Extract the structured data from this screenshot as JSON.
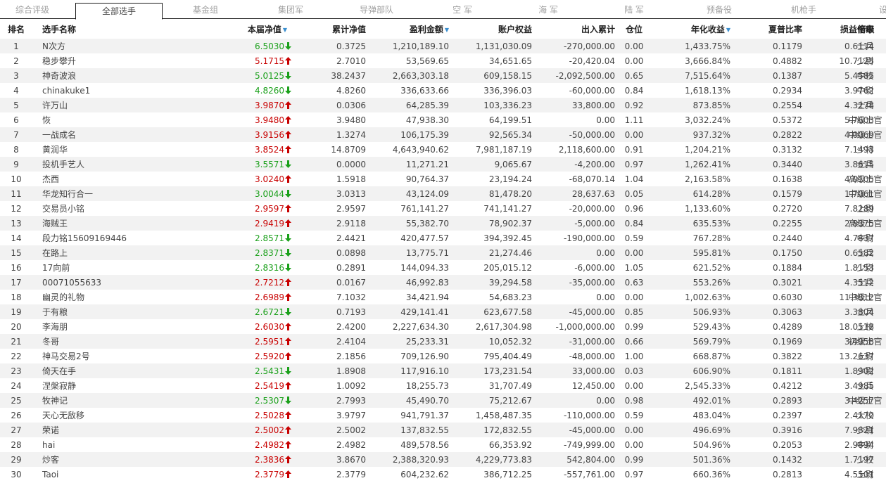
{
  "tabs": [
    "综合评级",
    "全部选手",
    "基金组",
    "集团军",
    "导弹部队",
    "空 军",
    "海 军",
    "陆 军",
    "预备役",
    "机枪手"
  ],
  "tab_more": "设",
  "active_tab": 1,
  "headers": [
    "排名",
    "选手名称",
    "本届净值",
    "累计净值",
    "盈利金额",
    "账户权益",
    "出入累计",
    "仓位",
    "年化收益",
    "夏普比率",
    "损益倍率",
    "衔级"
  ],
  "sorted_columns": [
    2,
    4,
    9
  ],
  "sort_icon": "▼",
  "colors": {
    "up": "#c80000",
    "down": "#1aa01a"
  },
  "rows": [
    {
      "rank": "1",
      "name": "N次方",
      "nav": "6.5030",
      "dir": "down",
      "cum": "0.3725",
      "profit": "1,210,189.10",
      "equity": "1,131,030.09",
      "flow": "-270,000.00",
      "pos": "0.00",
      "annual": "1,433.75%",
      "sharpe": "0.1179",
      "pl": "0.6114",
      "grade": "士兵"
    },
    {
      "rank": "2",
      "name": "稳步攀升",
      "nav": "5.1715",
      "dir": "up",
      "cum": "2.7010",
      "profit": "53,569.65",
      "equity": "34,651.65",
      "flow": "-20,420.04",
      "pos": "0.00",
      "annual": "3,666.84%",
      "sharpe": "0.4882",
      "pl": "10.7125",
      "grade": "少尉"
    },
    {
      "rank": "3",
      "name": "神奇波浪",
      "nav": "5.0125",
      "dir": "down",
      "cum": "38.2437",
      "profit": "2,663,303.18",
      "equity": "609,158.15",
      "flow": "-2,092,500.00",
      "pos": "0.65",
      "annual": "7,515.64%",
      "sharpe": "0.1387",
      "pl": "5.4585",
      "grade": "中校"
    },
    {
      "rank": "4",
      "name": "chinakuke1",
      "nav": "4.8260",
      "dir": "down",
      "cum": "4.8260",
      "profit": "336,633.66",
      "equity": "336,396.03",
      "flow": "-60,000.00",
      "pos": "0.84",
      "annual": "1,618.13%",
      "sharpe": "0.2934",
      "pl": "3.9762",
      "grade": "中尉"
    },
    {
      "rank": "5",
      "name": "许万山",
      "nav": "3.9870",
      "dir": "up",
      "cum": "0.0306",
      "profit": "64,285.39",
      "equity": "103,336.23",
      "flow": "33,800.00",
      "pos": "0.92",
      "annual": "873.85%",
      "sharpe": "0.2554",
      "pl": "4.3278",
      "grade": "士兵"
    },
    {
      "rank": "6",
      "name": "恢",
      "nav": "3.9480",
      "dir": "up",
      "cum": "3.9480",
      "profit": "47,938.30",
      "equity": "64,199.51",
      "flow": "0.00",
      "pos": "1.11",
      "annual": "3,032.24%",
      "sharpe": "0.5372",
      "pl": "5.7603",
      "grade": "中级士官"
    },
    {
      "rank": "7",
      "name": "一战成名",
      "nav": "3.9156",
      "dir": "up",
      "cum": "1.3274",
      "profit": "106,175.39",
      "equity": "92,565.34",
      "flow": "-50,000.00",
      "pos": "0.00",
      "annual": "937.32%",
      "sharpe": "0.2822",
      "pl": "4.0069",
      "grade": "中级士官"
    },
    {
      "rank": "8",
      "name": "黄润华",
      "nav": "3.8524",
      "dir": "up",
      "cum": "14.8709",
      "profit": "4,643,940.62",
      "equity": "7,981,187.19",
      "flow": "2,118,600.00",
      "pos": "0.91",
      "annual": "1,204.21%",
      "sharpe": "0.3132",
      "pl": "7.1493",
      "grade": "少将"
    },
    {
      "rank": "9",
      "name": "投机手艺人",
      "nav": "3.5571",
      "dir": "down",
      "cum": "0.0000",
      "profit": "11,271.21",
      "equity": "9,065.67",
      "flow": "-4,200.00",
      "pos": "0.97",
      "annual": "1,262.41%",
      "sharpe": "0.3440",
      "pl": "3.8615",
      "grade": "士兵"
    },
    {
      "rank": "10",
      "name": "杰西",
      "nav": "3.0240",
      "dir": "up",
      "cum": "1.5918",
      "profit": "90,764.37",
      "equity": "23,194.24",
      "flow": "-68,070.14",
      "pos": "1.04",
      "annual": "2,163.58%",
      "sharpe": "0.1638",
      "pl": "4.0105",
      "grade": "高级士官"
    },
    {
      "rank": "11",
      "name": "华龙知行合一",
      "nav": "3.0044",
      "dir": "down",
      "cum": "3.0313",
      "profit": "43,124.09",
      "equity": "81,478.20",
      "flow": "28,637.63",
      "pos": "0.05",
      "annual": "614.28%",
      "sharpe": "0.1579",
      "pl": "1.7061",
      "grade": "中级士官"
    },
    {
      "rank": "12",
      "name": "交易员小铭",
      "nav": "2.9597",
      "dir": "up",
      "cum": "2.9597",
      "profit": "761,141.27",
      "equity": "741,141.27",
      "flow": "-20,000.00",
      "pos": "0.96",
      "annual": "1,133.60%",
      "sharpe": "0.2720",
      "pl": "7.8289",
      "grade": "上尉"
    },
    {
      "rank": "13",
      "name": "海贼王",
      "nav": "2.9419",
      "dir": "up",
      "cum": "2.9118",
      "profit": "55,382.70",
      "equity": "78,902.37",
      "flow": "-5,000.00",
      "pos": "0.84",
      "annual": "635.53%",
      "sharpe": "0.2255",
      "pl": "2.8375",
      "grade": "高级士官"
    },
    {
      "rank": "14",
      "name": "段力铭15609169446",
      "nav": "2.8571",
      "dir": "down",
      "cum": "2.4421",
      "profit": "420,477.57",
      "equity": "394,392.45",
      "flow": "-190,000.00",
      "pos": "0.59",
      "annual": "767.28%",
      "sharpe": "0.2440",
      "pl": "4.7837",
      "grade": "中尉"
    },
    {
      "rank": "15",
      "name": "在路上",
      "nav": "2.8371",
      "dir": "down",
      "cum": "0.0898",
      "profit": "13,775.71",
      "equity": "21,274.46",
      "flow": "0.00",
      "pos": "0.00",
      "annual": "595.81%",
      "sharpe": "0.1750",
      "pl": "0.6582",
      "grade": "士兵"
    },
    {
      "rank": "16",
      "name": "17向前",
      "nav": "2.8316",
      "dir": "down",
      "cum": "0.2891",
      "profit": "144,094.33",
      "equity": "205,015.12",
      "flow": "-6,000.00",
      "pos": "1.05",
      "annual": "621.52%",
      "sharpe": "0.1884",
      "pl": "1.8153",
      "grade": "少尉"
    },
    {
      "rank": "17",
      "name": "00071055633",
      "nav": "2.7212",
      "dir": "up",
      "cum": "0.0167",
      "profit": "46,992.83",
      "equity": "39,294.58",
      "flow": "-35,000.00",
      "pos": "0.63",
      "annual": "553.26%",
      "sharpe": "0.3021",
      "pl": "4.3512",
      "grade": "士兵"
    },
    {
      "rank": "18",
      "name": "幽灵的礼物",
      "nav": "2.6989",
      "dir": "up",
      "cum": "7.1032",
      "profit": "34,421.94",
      "equity": "54,683.23",
      "flow": "0.00",
      "pos": "0.00",
      "annual": "1,002.63%",
      "sharpe": "0.6030",
      "pl": "11.3812",
      "grade": "中级士官"
    },
    {
      "rank": "19",
      "name": "于有粮",
      "nav": "2.6721",
      "dir": "down",
      "cum": "0.7193",
      "profit": "429,141.41",
      "equity": "623,677.58",
      "flow": "-45,000.00",
      "pos": "0.85",
      "annual": "506.93%",
      "sharpe": "0.3063",
      "pl": "3.3804",
      "grade": "士兵"
    },
    {
      "rank": "20",
      "name": "李海朋",
      "nav": "2.6030",
      "dir": "up",
      "cum": "2.4200",
      "profit": "2,227,634.30",
      "equity": "2,617,304.98",
      "flow": "-1,000,000.00",
      "pos": "0.99",
      "annual": "529.43%",
      "sharpe": "0.4289",
      "pl": "18.0518",
      "grade": "上校"
    },
    {
      "rank": "21",
      "name": "冬哥",
      "nav": "2.5951",
      "dir": "up",
      "cum": "2.4104",
      "profit": "25,233.31",
      "equity": "10,052.32",
      "flow": "-31,000.00",
      "pos": "0.66",
      "annual": "569.79%",
      "sharpe": "0.1969",
      "pl": "3.4958",
      "grade": "初级士官"
    },
    {
      "rank": "22",
      "name": "神马交易2号",
      "nav": "2.5920",
      "dir": "up",
      "cum": "2.1856",
      "profit": "709,126.90",
      "equity": "795,404.49",
      "flow": "-48,000.00",
      "pos": "1.00",
      "annual": "668.87%",
      "sharpe": "0.3822",
      "pl": "13.2637",
      "grade": "上尉"
    },
    {
      "rank": "23",
      "name": "倚天在手",
      "nav": "2.5431",
      "dir": "down",
      "cum": "1.8908",
      "profit": "117,916.10",
      "equity": "173,231.54",
      "flow": "33,000.00",
      "pos": "0.03",
      "annual": "606.90%",
      "sharpe": "0.1811",
      "pl": "1.8902",
      "grade": "少尉"
    },
    {
      "rank": "24",
      "name": "涅槃寂静",
      "nav": "2.5419",
      "dir": "up",
      "cum": "1.0092",
      "profit": "18,255.73",
      "equity": "31,707.49",
      "flow": "12,450.00",
      "pos": "0.00",
      "annual": "2,545.33%",
      "sharpe": "0.4212",
      "pl": "3.4985",
      "grade": "士兵"
    },
    {
      "rank": "25",
      "name": "牧神记",
      "nav": "2.5307",
      "dir": "down",
      "cum": "2.7993",
      "profit": "45,490.70",
      "equity": "75,212.67",
      "flow": "0.00",
      "pos": "0.98",
      "annual": "492.01%",
      "sharpe": "0.2893",
      "pl": "3.4257",
      "grade": "中级士官"
    },
    {
      "rank": "26",
      "name": "天心无敌移",
      "nav": "2.5028",
      "dir": "up",
      "cum": "3.9797",
      "profit": "941,791.37",
      "equity": "1,458,487.35",
      "flow": "-110,000.00",
      "pos": "0.59",
      "annual": "483.04%",
      "sharpe": "0.2397",
      "pl": "2.4170",
      "grade": "大校"
    },
    {
      "rank": "27",
      "name": "荣诺",
      "nav": "2.5002",
      "dir": "up",
      "cum": "2.5002",
      "profit": "137,832.55",
      "equity": "172,832.55",
      "flow": "-45,000.00",
      "pos": "0.00",
      "annual": "496.69%",
      "sharpe": "0.3916",
      "pl": "7.9821",
      "grade": "少尉"
    },
    {
      "rank": "28",
      "name": "hai",
      "nav": "2.4982",
      "dir": "up",
      "cum": "2.4982",
      "profit": "489,578.56",
      "equity": "66,353.92",
      "flow": "-749,999.00",
      "pos": "0.00",
      "annual": "504.96%",
      "sharpe": "0.2053",
      "pl": "2.9894",
      "grade": "中尉"
    },
    {
      "rank": "29",
      "name": "炒客",
      "nav": "2.3836",
      "dir": "up",
      "cum": "3.8670",
      "profit": "2,388,320.93",
      "equity": "4,229,773.83",
      "flow": "542,804.00",
      "pos": "0.99",
      "annual": "501.36%",
      "sharpe": "0.1432",
      "pl": "1.7197",
      "grade": "少校"
    },
    {
      "rank": "30",
      "name": "Taoi",
      "nav": "2.3779",
      "dir": "up",
      "cum": "2.3779",
      "profit": "604,232.62",
      "equity": "386,712.25",
      "flow": "-557,761.00",
      "pos": "0.97",
      "annual": "660.36%",
      "sharpe": "0.2813",
      "pl": "4.5501",
      "grade": "上尉"
    }
  ]
}
